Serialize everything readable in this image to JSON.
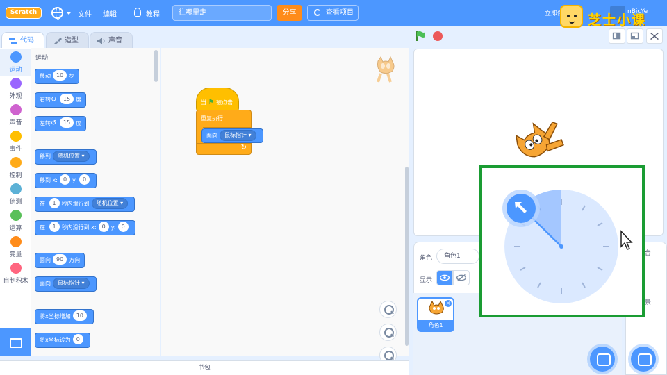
{
  "topbar": {
    "logo_text": "Scratch",
    "menu_file": "文件",
    "menu_edit": "编辑",
    "menu_tutorials": "教程",
    "project_title": "往哪里走",
    "share_label": "分享",
    "see_project_label": "查看项目",
    "right_text": "立即保",
    "right_text2": "nBicYe",
    "accent_color": "#4c97ff"
  },
  "watermark": {
    "text": "芝士小课"
  },
  "tabs": [
    {
      "label": "代码"
    },
    {
      "label": "造型"
    },
    {
      "label": "声音"
    }
  ],
  "categories": [
    {
      "label": "运动",
      "color": "#4c97ff"
    },
    {
      "label": "外观",
      "color": "#9966ff"
    },
    {
      "label": "声音",
      "color": "#cf63cf"
    },
    {
      "label": "事件",
      "color": "#ffbf00"
    },
    {
      "label": "控制",
      "color": "#ffab19"
    },
    {
      "label": "侦测",
      "color": "#5cb1d6"
    },
    {
      "label": "运算",
      "color": "#59c059"
    },
    {
      "label": "变量",
      "color": "#ff8c1a"
    },
    {
      "label": "自制积木",
      "color": "#ff6680"
    }
  ],
  "palette": {
    "section_title": "运动",
    "move": {
      "a": "移动",
      "n": "10",
      "b": "步"
    },
    "turn_right": {
      "a": "右转",
      "n": "15",
      "b": "度"
    },
    "turn_left": {
      "a": "左转",
      "n": "15",
      "b": "度"
    },
    "goto": {
      "a": "移到",
      "d": "随机位置"
    },
    "goto_xy": {
      "a": "移到 x:",
      "x": "0",
      "y_lbl": "y:",
      "y": "0"
    },
    "glide1": {
      "a": "在",
      "n": "1",
      "b": "秒内滑行到",
      "d": "随机位置"
    },
    "glide2": {
      "a": "在",
      "n": "1",
      "b": "秒内滑行到 x:",
      "x": "0",
      "y_lbl": "y:",
      "y": "0"
    },
    "point_dir": {
      "a": "面向",
      "n": "90",
      "b": "方向"
    },
    "point_towards": {
      "a": "面向",
      "d": "鼠标指针"
    },
    "change_x": {
      "a": "将x坐标增加",
      "n": "10"
    },
    "set_x": {
      "a": "将x坐标设为",
      "n": "0"
    }
  },
  "script": {
    "hat_a": "当",
    "hat_b": "被点击",
    "forever": "重复执行",
    "point_a": "面向",
    "point_d": "鼠标指针",
    "arrow": "↻"
  },
  "backpack": {
    "label": "书包"
  },
  "sprite_info": {
    "sprite_label": "角色",
    "sprite_name": "角色1",
    "show_label": "显示",
    "stage_label": "台",
    "stage_label2": "景"
  },
  "sprite_list": [
    {
      "name": "角色1"
    }
  ],
  "direction_popup": {
    "border_color": "#1a9c33",
    "dial_color": "#b8d4ff"
  }
}
